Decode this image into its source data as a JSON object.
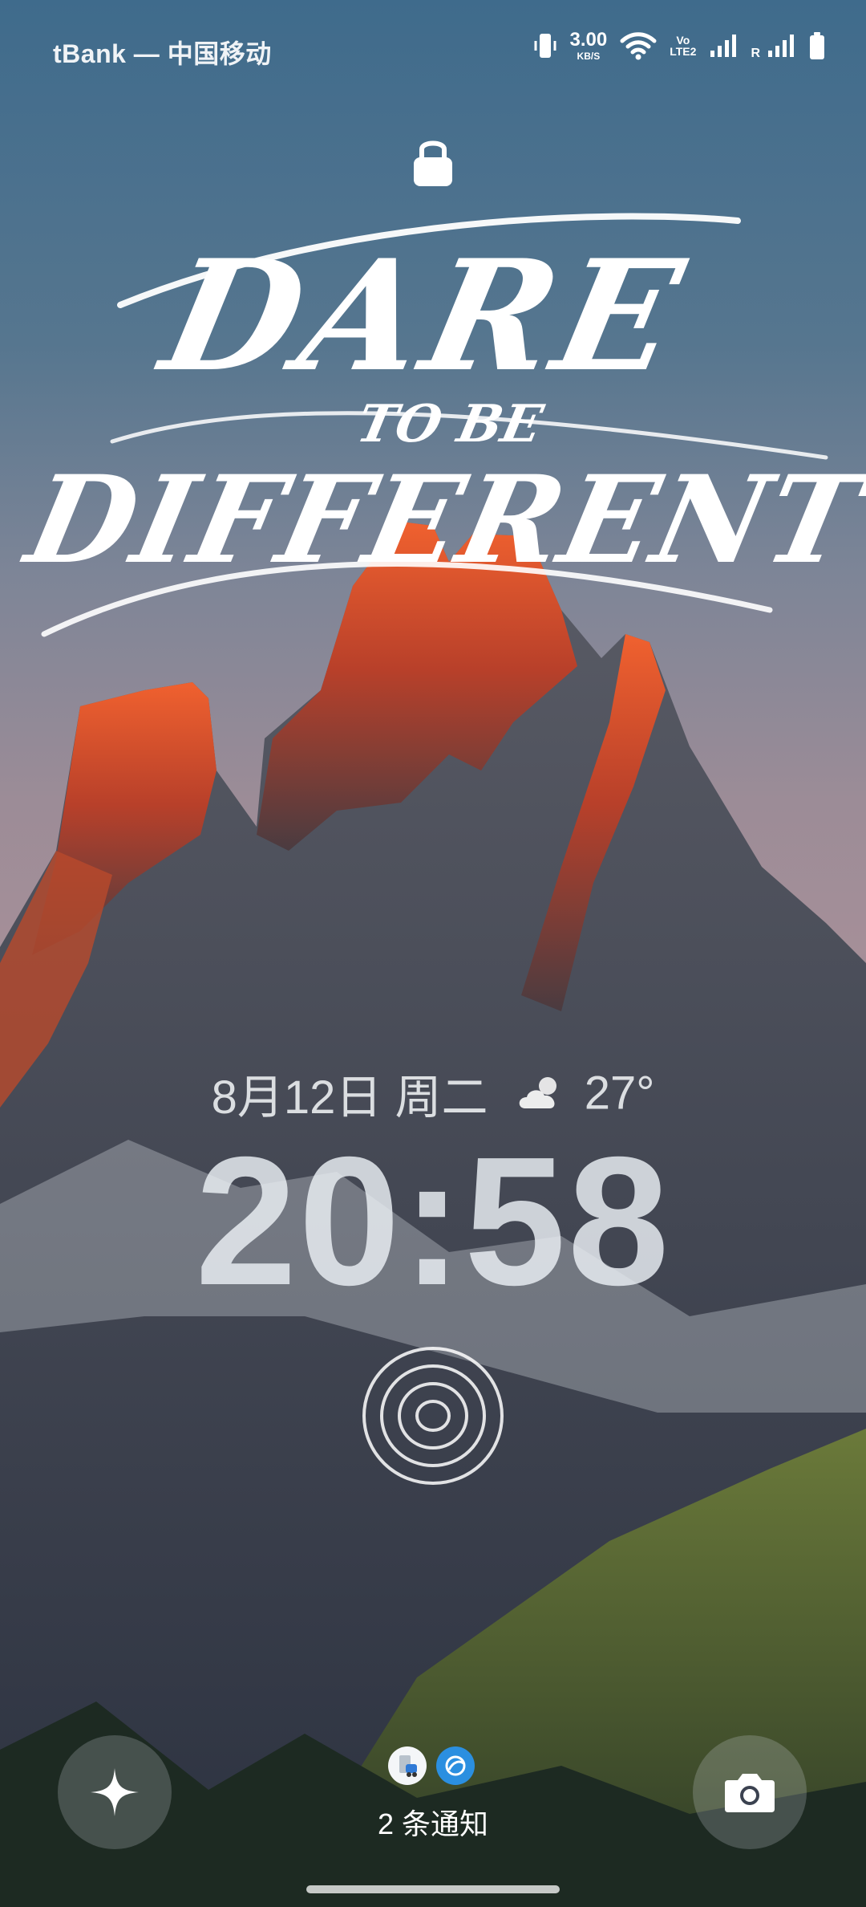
{
  "status_bar": {
    "carrier": "tBank — 中国移动",
    "speed_value": "3.00",
    "speed_unit": "KB/S",
    "volte_top": "Vo",
    "volte_bottom": "LTE2",
    "roaming": "R",
    "icons": [
      "vibrate-icon",
      "wifi-icon",
      "volte-icon",
      "signal-sim1-icon",
      "signal-sim2-icon",
      "battery-icon"
    ]
  },
  "lock": {
    "icon": "lock-icon"
  },
  "wallpaper": {
    "slogan_line1": "DARE",
    "slogan_line2": "TO BE",
    "slogan_line3": "DIFFERENT"
  },
  "date": {
    "text": "8月12日 周二",
    "weather_icon": "partly-cloudy-icon",
    "temperature": "27°"
  },
  "clock": {
    "time": "20:58"
  },
  "fingerprint": {
    "icon": "fingerprint-icon"
  },
  "shortcuts": {
    "left_icon": "sparkle-icon",
    "right_icon": "camera-icon"
  },
  "notifications": {
    "apps": [
      "transit-app-icon",
      "browser-app-icon"
    ],
    "count_text": "2 条通知"
  },
  "colors": {
    "sky_top": "#3f6b8c",
    "sky_mid": "#a58f98",
    "peak_glow": "#e0512c",
    "mountain_shadow": "#3a3f4c",
    "grass": "#56683a"
  }
}
